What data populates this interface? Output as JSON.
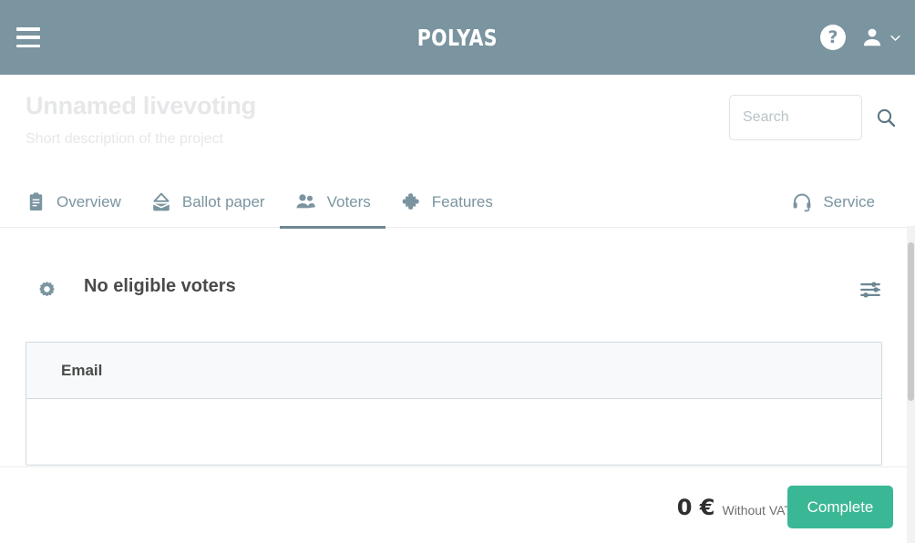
{
  "topbar": {
    "menu_icon": "hamburger-menu-icon",
    "brand": "POLYAS",
    "help_icon": "?",
    "account_icon": "person-icon",
    "chevron_icon": "chevron-down-icon"
  },
  "project": {
    "title": "Unnamed livevoting",
    "description": "Short description of the project"
  },
  "search": {
    "value": "",
    "placeholder": "Search",
    "icon": "search-icon"
  },
  "tabs": [
    {
      "label": "Overview",
      "icon": "clipboard-icon",
      "active": false
    },
    {
      "label": "Ballot paper",
      "icon": "ballot-box-icon",
      "active": false
    },
    {
      "label": "Voters",
      "icon": "people-icon",
      "active": true
    },
    {
      "label": "Features",
      "icon": "puzzle-piece-icon",
      "active": false
    },
    {
      "label": "Service",
      "icon": "headset-icon",
      "active": false
    }
  ],
  "section": {
    "gear_icon": "gear-icon",
    "title": "No eligible voters",
    "filter_icon": "filter-sliders-icon"
  },
  "table": {
    "columns": [
      "Email"
    ],
    "rows": []
  },
  "footer": {
    "price_amount": "0 €",
    "price_note": "Without VAT",
    "complete_label": "Complete"
  },
  "colors": {
    "header_bg": "#7a94a0",
    "accent": "#7a94a0",
    "complete_green": "#3ab795",
    "title_placeholder": "#e6e7e8",
    "table_border": "#cfd9de",
    "table_head_bg": "#f7f9fa"
  }
}
